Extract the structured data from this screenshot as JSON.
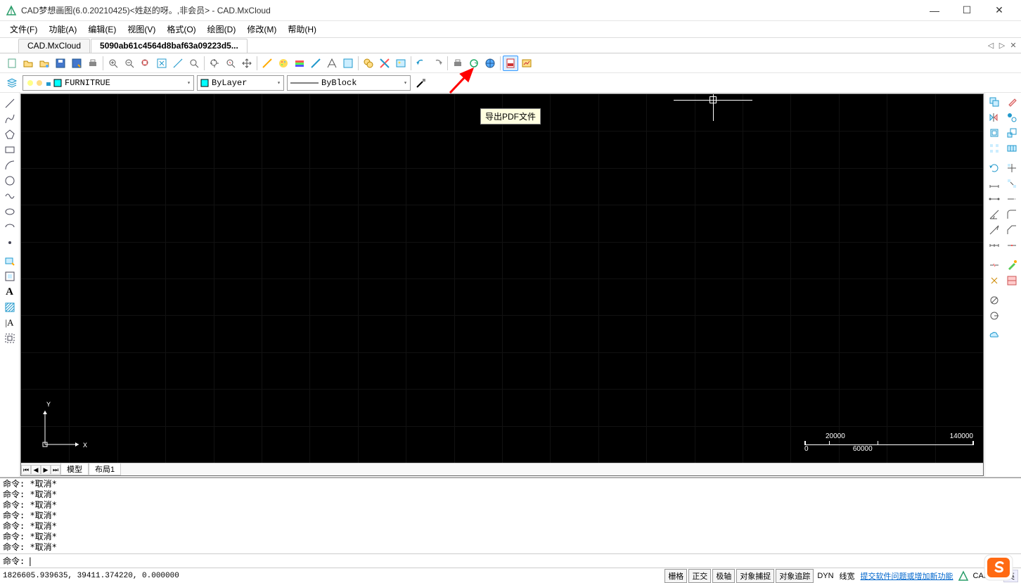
{
  "title": "CAD梦想画图(6.0.20210425)<姓赵的呀。,非会员> - CAD.MxCloud",
  "menubar": [
    {
      "label": "文件(F)"
    },
    {
      "label": "功能(A)"
    },
    {
      "label": "编辑(E)"
    },
    {
      "label": "视图(V)"
    },
    {
      "label": "格式(O)"
    },
    {
      "label": "绘图(D)"
    },
    {
      "label": "修改(M)"
    },
    {
      "label": "帮助(H)"
    }
  ],
  "tabs": [
    {
      "label": "CAD.MxCloud",
      "active": false
    },
    {
      "label": "5090ab61c4564d8baf63a09223d5...",
      "active": true
    }
  ],
  "tooltip": "导出PDF文件",
  "layer_dropdown": {
    "value": "FURNITRUE"
  },
  "color_dropdown": {
    "value": "ByLayer"
  },
  "linetype_dropdown": {
    "value": "ByBlock"
  },
  "layout_tabs": [
    {
      "label": "模型",
      "active": true
    },
    {
      "label": "布局1",
      "active": false
    }
  ],
  "cmd_history": [
    "命令:  *取消*",
    "命令:  *取消*",
    "命令:  *取消*",
    "命令:  *取消*",
    "命令:  *取消*",
    "命令:  *取消*",
    "命令:  *取消*"
  ],
  "cmd_prompt": "命令:",
  "coords": "1826605.939635,  39411.374220,  0.000000",
  "status_buttons": [
    "栅格",
    "正交",
    "极轴",
    "对象捕捉",
    "对象追踪"
  ],
  "status_extra": [
    "DYN",
    "线宽"
  ],
  "status_link": "提交软件问题或增加新功能",
  "status_right": "CAD.M",
  "ime": "英",
  "scale": {
    "ticks": [
      "0",
      "20000",
      "60000",
      "140000"
    ]
  },
  "ucs": {
    "x": "X",
    "y": "Y"
  }
}
